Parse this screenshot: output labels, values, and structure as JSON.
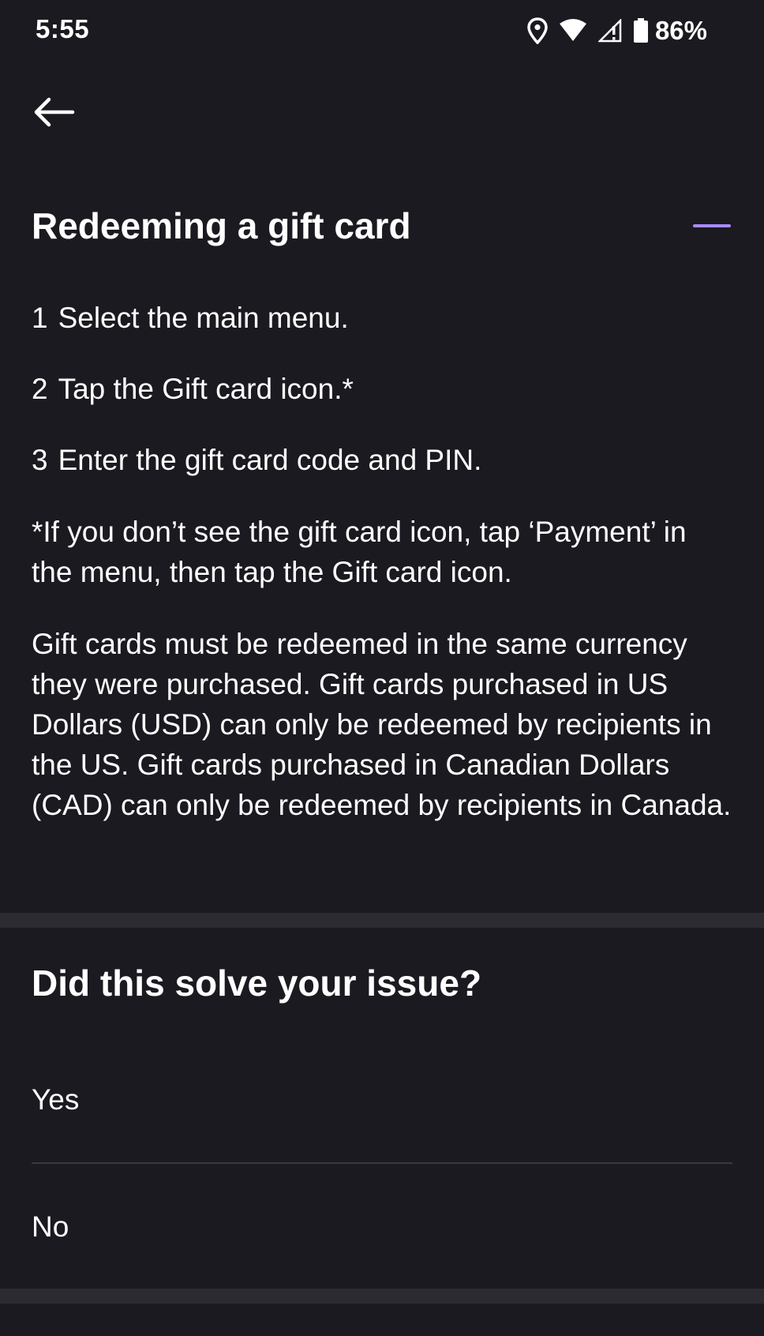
{
  "status_bar": {
    "time": "5:55",
    "battery_percent": "86%",
    "icons": [
      "location-icon",
      "wifi-icon",
      "signal-icon",
      "battery-icon"
    ]
  },
  "app_bar": {
    "back_icon": "back-arrow-icon"
  },
  "section": {
    "title": "Redeeming a gift card",
    "collapse_icon": "minus-icon",
    "accent_color": "#a78bfa",
    "steps": [
      {
        "number": "1",
        "text": "Select the main menu."
      },
      {
        "number": "2",
        "text": "Tap the Gift card icon.*"
      },
      {
        "number": "3",
        "text": "Enter the gift card code and PIN."
      }
    ],
    "footnote": "*If you don’t see the gift card icon, tap ‘Payment’ in the menu, then tap the Gift card icon.",
    "currency_note": "Gift cards must be redeemed in the same currency they were purchased. Gift cards purchased in US Dollars (USD) can only be redeemed by recipients in the US. Gift cards purchased in Canadian Dollars (CAD) can only be redeemed by recipients in Canada."
  },
  "feedback": {
    "question": "Did this solve your issue?",
    "options": [
      "Yes",
      "No"
    ]
  },
  "colors": {
    "background": "#1a1a20",
    "band": "#2b2b31",
    "text": "#ffffff"
  }
}
